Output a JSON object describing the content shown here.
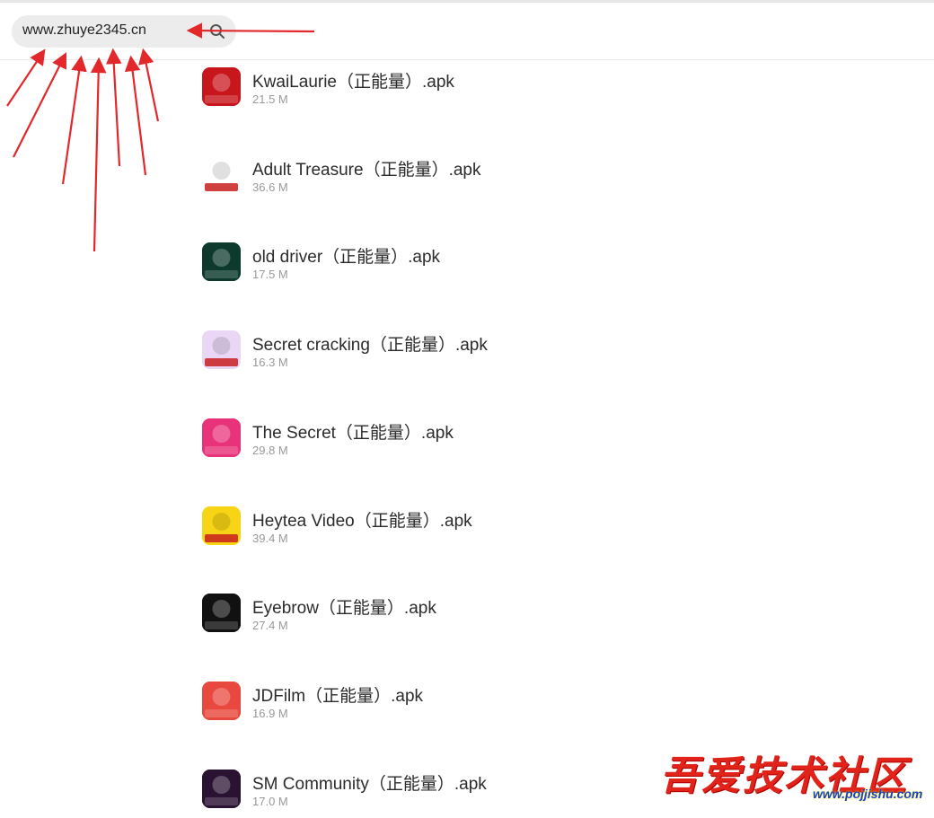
{
  "search": {
    "value": "www.zhuye2345.cn"
  },
  "apps": [
    {
      "name": "KwaiLaurie（正能量）.apk",
      "size": "21.5 M",
      "icon": "kwailaurie-icon",
      "icon_text": "快手萝莉",
      "bg": "#c8161d"
    },
    {
      "name": "Adult Treasure（正能量）.apk",
      "size": "36.6 M",
      "icon": "adult-treasure-icon",
      "icon_text": "成人版",
      "bg": "#ffffff"
    },
    {
      "name": "old driver（正能量）.apk",
      "size": "17.5 M",
      "icon": "old-driver-icon",
      "icon_text": "老司机",
      "bg": "#0d3a2c"
    },
    {
      "name": "Secret cracking（正能量）.apk",
      "size": "16.3 M",
      "icon": "secret-cracking-icon",
      "icon_text": "破解撩妹",
      "bg": "#e9d7f5"
    },
    {
      "name": "The Secret（正能量）.apk",
      "size": "29.8 M",
      "icon": "the-secret-icon",
      "icon_text": "秘密花园",
      "bg": "#e8337b"
    },
    {
      "name": "Heytea Video（正能量）.apk",
      "size": "39.4 M",
      "icon": "heytea-video-icon",
      "icon_text": "喜茶视频",
      "bg": "#f7d416"
    },
    {
      "name": "Eyebrow（正能量）.apk",
      "size": "27.4 M",
      "icon": "eyebrow-icon",
      "icon_text": "黑归",
      "bg": "#111111"
    },
    {
      "name": "JDFilm（正能量）.apk",
      "size": "16.9 M",
      "icon": "jdfilm-icon",
      "icon_text": "京东影业",
      "bg": "#e8483e"
    },
    {
      "name": "SM Community（正能量）.apk",
      "size": "17.0 M",
      "icon": "sm-community-icon",
      "icon_text": "SM社区",
      "bg": "#2a1233"
    }
  ],
  "watermark": {
    "text": "吾爱技术社区",
    "url": "www.pojjishu.com"
  },
  "colors": {
    "arrow": "#e3282b",
    "search_bg": "#ececec",
    "size_text": "#999999"
  }
}
